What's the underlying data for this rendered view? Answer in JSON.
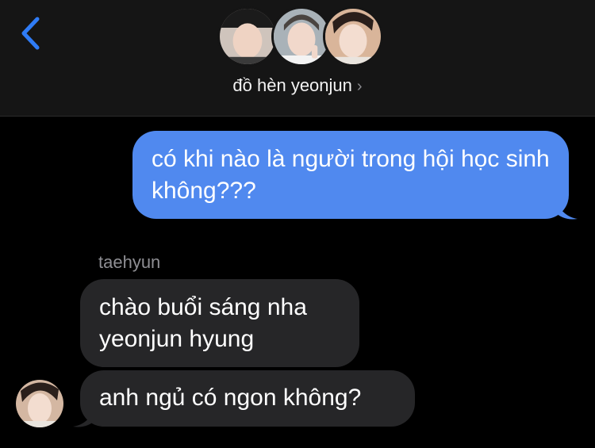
{
  "header": {
    "title": "đồ hèn yeonjun",
    "chevron": "›",
    "back_icon": "chevron-left-icon",
    "accent_color": "#2f7cf6"
  },
  "messages": [
    {
      "direction": "sent",
      "text": "có khi nào là người trong hội học sinh không???"
    },
    {
      "direction": "received",
      "sender": "taehyun",
      "text": "chào buổi sáng nha yeonjun hyung"
    },
    {
      "direction": "received",
      "sender": "taehyun",
      "text": "anh ngủ có ngon không?"
    }
  ],
  "colors": {
    "sent_bubble": "#5089ef",
    "received_bubble": "#262628",
    "background": "#000000",
    "header_bg": "#151515"
  }
}
